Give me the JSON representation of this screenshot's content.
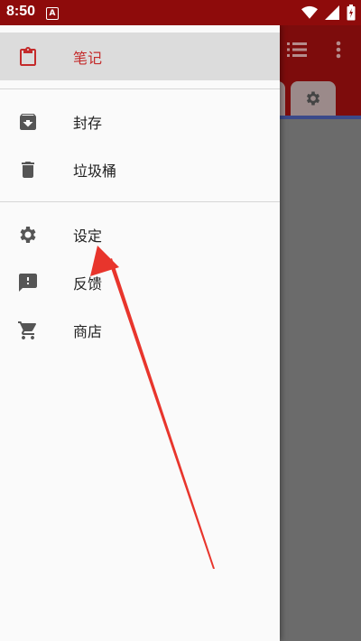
{
  "status_bar": {
    "time": "8:50",
    "notification_glyph": "A"
  },
  "drawer": {
    "items": [
      {
        "label": "笔记",
        "icon": "clipboard-icon",
        "active": true
      },
      {
        "label": "封存",
        "icon": "archive-icon",
        "active": false
      },
      {
        "label": "垃圾桶",
        "icon": "trash-icon",
        "active": false
      },
      {
        "label": "设定",
        "icon": "gear-icon",
        "active": false
      },
      {
        "label": "反馈",
        "icon": "feedback-icon",
        "active": false
      },
      {
        "label": "商店",
        "icon": "cart-icon",
        "active": false
      }
    ]
  },
  "colors": {
    "status_bar": "#8e0b0b",
    "toolbar": "#7d0c0c",
    "active_accent": "#c42b2b",
    "arrow": "#e8352c",
    "scrim": "#6b6b6b"
  }
}
